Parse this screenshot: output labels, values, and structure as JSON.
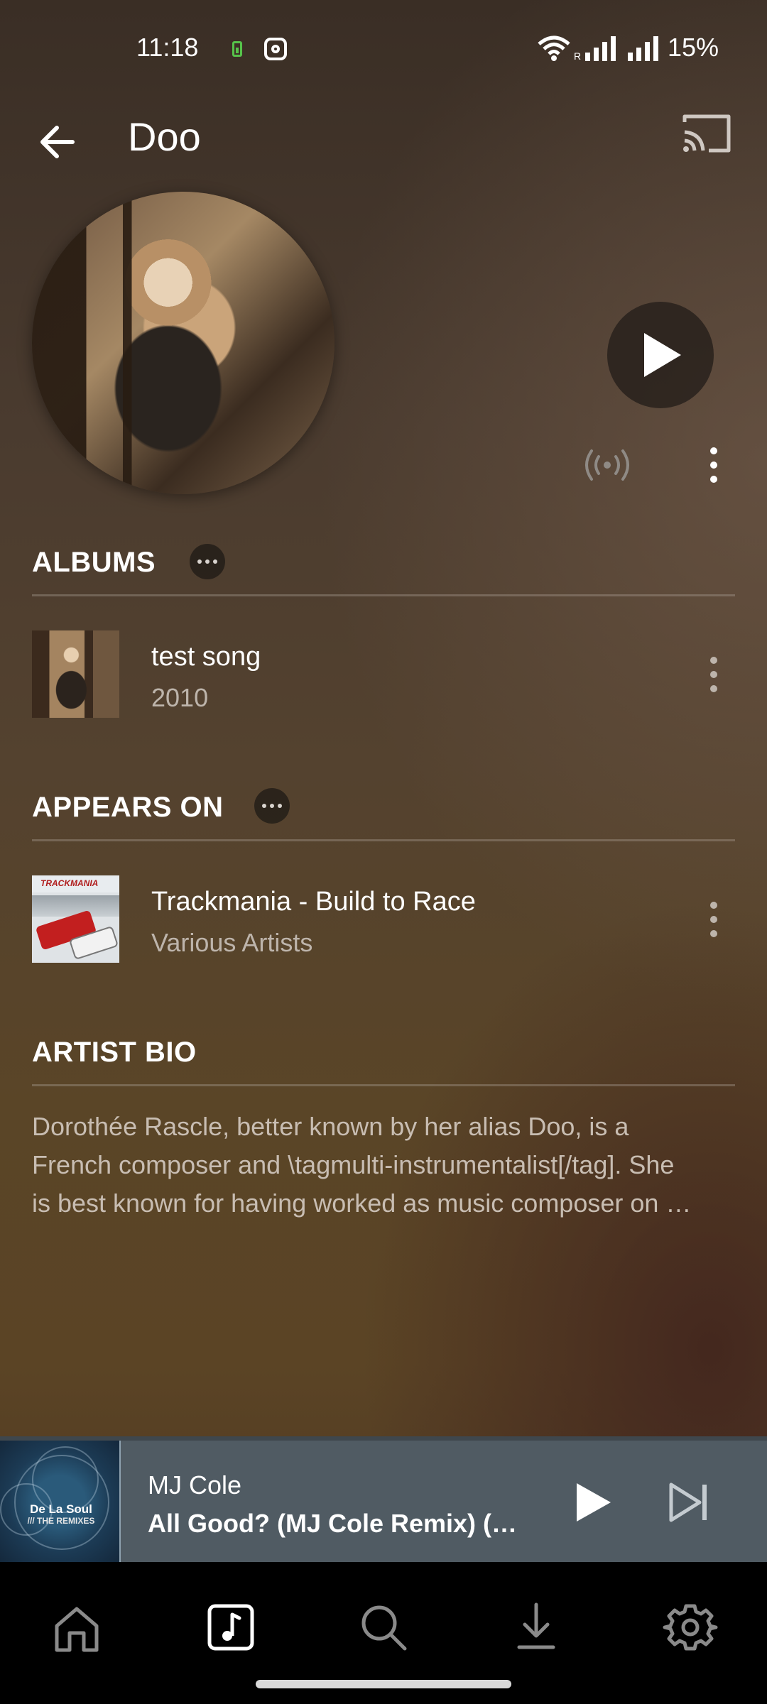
{
  "status_bar": {
    "time": "11:18",
    "battery_percent": "15%",
    "icons": [
      "battery-charging-icon",
      "instagram-icon",
      "wifi-icon",
      "signal-icon",
      "signal-icon"
    ]
  },
  "header": {
    "title": "Doo",
    "back_icon": "arrow-left-icon",
    "cast_icon": "cast-icon"
  },
  "artist": {
    "actions": [
      "play-icon",
      "radio-icon",
      "more-vertical-icon"
    ]
  },
  "albums_section": {
    "title": "ALBUMS",
    "items": [
      {
        "title": "test song",
        "subtitle": "2010"
      }
    ]
  },
  "appears_on_section": {
    "title": "APPEARS ON",
    "items": [
      {
        "title": "Trackmania - Build to Race",
        "subtitle": "Various Artists",
        "art_text": "TRACKMANIA"
      }
    ]
  },
  "bio_section": {
    "title": "ARTIST BIO",
    "lines": [
      "Dorothée Rascle, better known by her alias Doo, is a",
      "French composer and \\tagmulti-instrumentalist[/tag]. She",
      "is best known for having worked as music composer on …"
    ]
  },
  "mini_player": {
    "artist": "MJ Cole",
    "track": "All Good? (MJ Cole Remix) (…",
    "art_text_1": "De La Soul",
    "art_text_2": "/// THE REMIXES"
  },
  "bottom_nav": {
    "items": [
      "home-icon",
      "music-library-icon",
      "search-icon",
      "download-icon",
      "settings-icon"
    ],
    "selected": "music-library-icon"
  },
  "colors": {
    "mini_player_bg": "#505b63",
    "nav_bg": "#000000"
  }
}
